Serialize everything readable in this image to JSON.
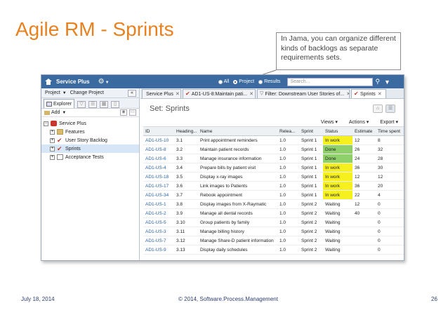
{
  "slide": {
    "title": "Agile RM - Sprints",
    "callout": "In Jama, you can organize different kinds of backlogs as separate requirements sets.",
    "footer_date": "July 18, 2014",
    "footer_copyright": "© 2014, Software.Process.Management",
    "footer_page": "26"
  },
  "topbar": {
    "app_name": "Service Plus",
    "filter_all": "All",
    "filter_project": "Project",
    "filter_results": "Results",
    "search_placeholder": "Search..."
  },
  "left": {
    "project_menu": "Project",
    "change_project": "Change Project",
    "collapse_label": "«",
    "explorer_tab": "Explorer",
    "add_label": "Add",
    "tree": [
      {
        "label": "Service Plus",
        "icon": "project-icon"
      },
      {
        "label": "Features",
        "icon": "folder-icon"
      },
      {
        "label": "User Story Backlog",
        "icon": "checkmark-icon"
      },
      {
        "label": "Sprints",
        "icon": "checkmark-icon"
      },
      {
        "label": "Acceptance Tests",
        "icon": "document-icon"
      }
    ]
  },
  "tabs": [
    {
      "label": "Service Plus"
    },
    {
      "label": "AD1-US-8:Maintain pati..."
    },
    {
      "label": "Filter: Downstream User Stories of..."
    },
    {
      "label": "Sprints"
    }
  ],
  "set_title": "Set: Sprints",
  "actions": {
    "views": "Views",
    "actions": "Actions",
    "export": "Export"
  },
  "table": {
    "headers": [
      "ID",
      "Heading...",
      "Name",
      "Relea...",
      "Sprint",
      "Status",
      "Estimate",
      "Time spent"
    ],
    "rows": [
      [
        "AD1-US-10",
        "3.1",
        "Print appointment reminders",
        "1.0",
        "Sprint 1",
        "In work",
        "12",
        "8"
      ],
      [
        "AD1-US-8",
        "3.2",
        "Maintain patient records",
        "1.0",
        "Sprint 1",
        "Done",
        "26",
        "32"
      ],
      [
        "AD1-US-6",
        "3.3",
        "Manage insurance information",
        "1.0",
        "Sprint 1",
        "Done",
        "24",
        "28"
      ],
      [
        "AD1-US-4",
        "3.4",
        "Prepare bills by patient visit",
        "1.0",
        "Sprint 1",
        "In work",
        "36",
        "30"
      ],
      [
        "AD1-US-18",
        "3.5",
        "Display x-ray images",
        "1.0",
        "Sprint 1",
        "In work",
        "12",
        "12"
      ],
      [
        "AD1-US-17",
        "3.6",
        "Link images to Patients",
        "1.0",
        "Sprint 1",
        "In work",
        "36",
        "20"
      ],
      [
        "AD1-US-34",
        "3.7",
        "Rebook appointment",
        "1.0",
        "Sprint 1",
        "In work",
        "22",
        "4"
      ],
      [
        "AD1-US-1",
        "3.8",
        "Display images from X-Raymatic",
        "1.0",
        "Sprint 2",
        "Waiting",
        "12",
        "0"
      ],
      [
        "AD1-US-2",
        "3.9",
        "Manage all dental records",
        "1.0",
        "Sprint 2",
        "Waiting",
        "40",
        "0"
      ],
      [
        "AD1-US-5",
        "3.10",
        "Group patients by family",
        "1.0",
        "Sprint 2",
        "Waiting",
        "",
        "0"
      ],
      [
        "AD1-US-3",
        "3.11",
        "Manage billing history",
        "1.0",
        "Sprint 2",
        "Waiting",
        "",
        "0"
      ],
      [
        "AD1-US-7",
        "3.12",
        "Manage Share-D patient information",
        "1.0",
        "Sprint 2",
        "Waiting",
        "",
        "0"
      ],
      [
        "AD1-US-9",
        "3.13",
        "Display daily schedules",
        "1.0",
        "Sprint 2",
        "Waiting",
        "",
        "0"
      ]
    ]
  },
  "colors": {
    "title": "#e8811f",
    "topbar": "#3a6aa0",
    "in_work": "#f5f01e",
    "done": "#8fd06a",
    "link": "#2a62a8"
  }
}
